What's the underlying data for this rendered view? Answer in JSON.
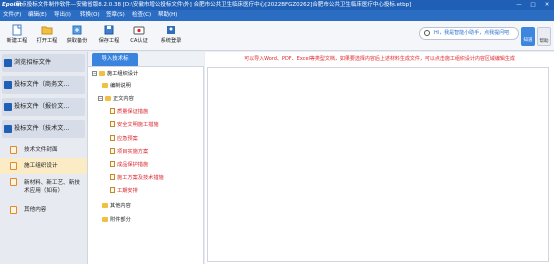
{
  "titlebar": {
    "app_logo": "Epoint",
    "text": "新点投标文件制作软件—安徽省版8.2.0.38 [D:\\安徽市增公投标文件\\外] 合肥市公共卫生临床医疗中心[2022BFGZ0262]合肥市公共卫生临床医疗中心投标.etbp]",
    "controls": [
      "—",
      "□",
      "✕"
    ]
  },
  "menu": [
    "文件(F)",
    "编辑(E)",
    "导出(I)",
    "转换(O)",
    "签章(S)",
    "检查(C)",
    "帮助(H)"
  ],
  "toolbar": [
    {
      "label": "新建工程",
      "icon": "new-project-icon"
    },
    {
      "label": "打开工程",
      "icon": "open-project-icon"
    },
    {
      "label": "获取备份",
      "icon": "backup-icon"
    },
    {
      "label": "保存工程",
      "icon": "save-icon"
    },
    {
      "label": "CA认证",
      "icon": "ca-cert-icon"
    },
    {
      "label": "系统登录",
      "icon": "login-icon"
    }
  ],
  "search": {
    "text": "Hi，我是智能小助手，点我提问吧"
  },
  "right_buttons": [
    "知道",
    "帮助"
  ],
  "sidebar": {
    "top": "浏览招标文件",
    "sections": [
      {
        "label": "投标文件（商务文..."
      },
      {
        "label": "投标文件（报价文..."
      },
      {
        "label": "投标文件（技术文..."
      }
    ],
    "subitems": [
      "技术文件封面",
      "施工组织设计",
      "新材料、新工艺、新技术应用（如有）",
      "其他内容"
    ]
  },
  "tree": {
    "tab": "导入技术标",
    "nodes": [
      {
        "label": "施工组织设计",
        "kind": "root"
      },
      {
        "label": "编制说明",
        "kind": "blk"
      },
      {
        "label": "正文内容",
        "kind": "blk"
      },
      {
        "label": "质量保证措施",
        "kind": "red"
      },
      {
        "label": "安全文明施工措施",
        "kind": "red"
      },
      {
        "label": "应急预案",
        "kind": "red"
      },
      {
        "label": "项目实施方案",
        "kind": "red"
      },
      {
        "label": "成品保护措施",
        "kind": "red"
      },
      {
        "label": "施工方案及技术措施",
        "kind": "red"
      },
      {
        "label": "工期安排",
        "kind": "red"
      },
      {
        "label": "其他内容",
        "kind": "blk"
      },
      {
        "label": "附件部分",
        "kind": "blk"
      }
    ]
  },
  "content": {
    "hint": "可以导入Word、PDF、Excel等类型文档，如果要选择内容后上述材料生成文件，可以点击施工组织设计内容区域编辑生成",
    "editor_value": ""
  },
  "colors": {
    "titlebar": "#1f5fb5",
    "menubar": "#2c6dc4",
    "accent": "#3a84df",
    "red_text": "#d8262d",
    "active_row": "#fbecc5"
  }
}
